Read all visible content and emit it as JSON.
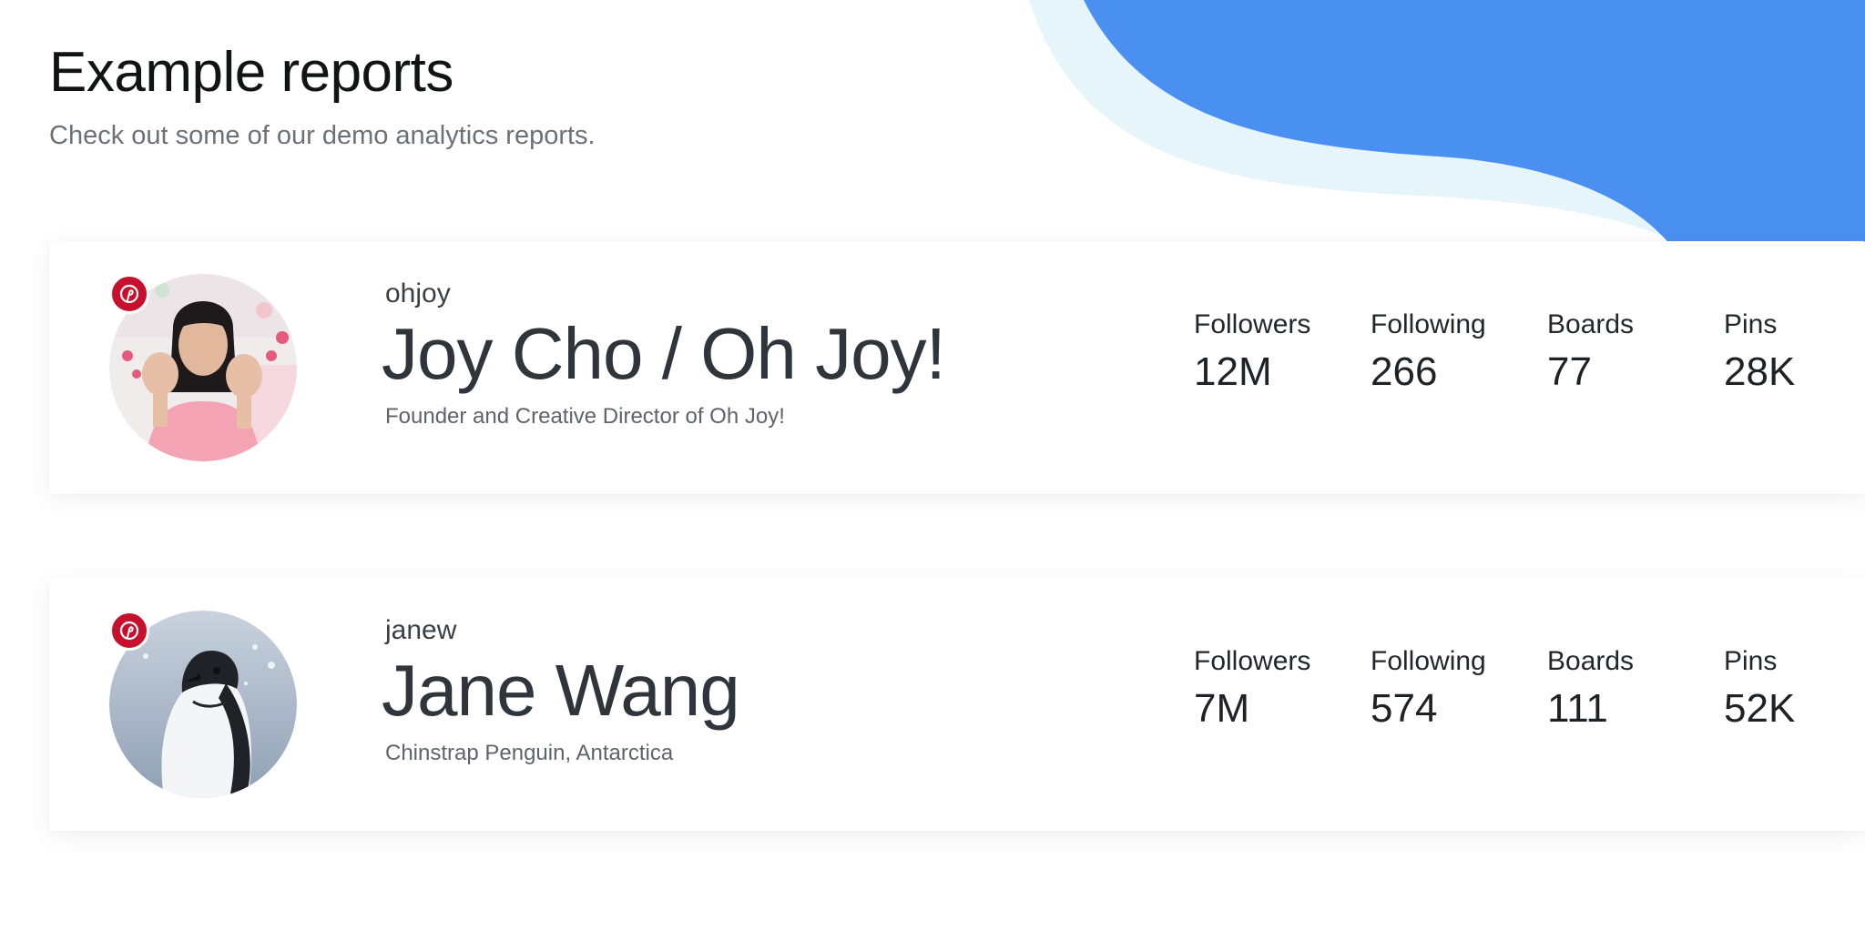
{
  "header": {
    "title": "Example reports",
    "subtitle": "Check out some of our demo analytics reports."
  },
  "colors": {
    "wave_blue": "#4a90f0",
    "wave_light": "#e6f5fa",
    "pinterest_red": "#c8102e"
  },
  "reports": [
    {
      "username": "ohjoy",
      "display_name": "Joy Cho / Oh Joy!",
      "bio": "Founder and Creative Director of Oh Joy!",
      "avatar_icon": "photo-woman-waving",
      "platform_icon": "pinterest-icon",
      "stats": [
        {
          "label": "Followers",
          "value": "12M"
        },
        {
          "label": "Following",
          "value": "266"
        },
        {
          "label": "Boards",
          "value": "77"
        },
        {
          "label": "Pins",
          "value": "28K"
        }
      ]
    },
    {
      "username": "janew",
      "display_name": "Jane Wang",
      "bio": "Chinstrap Penguin, Antarctica",
      "avatar_icon": "photo-chinstrap-penguin",
      "platform_icon": "pinterest-icon",
      "stats": [
        {
          "label": "Followers",
          "value": "7M"
        },
        {
          "label": "Following",
          "value": "574"
        },
        {
          "label": "Boards",
          "value": "111"
        },
        {
          "label": "Pins",
          "value": "52K"
        }
      ]
    }
  ]
}
